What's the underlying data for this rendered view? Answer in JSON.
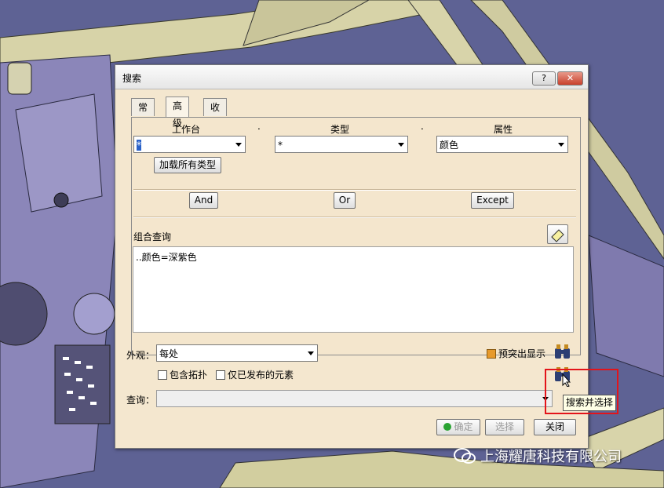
{
  "dialog": {
    "title": "搜索",
    "help_label": "?",
    "close_label": "✕"
  },
  "tabs": [
    {
      "label": "常规",
      "active": false
    },
    {
      "label": "高级",
      "active": true
    },
    {
      "label": "收藏夹",
      "active": false
    }
  ],
  "advanced": {
    "workbench_label": "工作台",
    "type_label": "类型",
    "attribute_label": "属性",
    "separator_dot": ".",
    "workbench_value": "*",
    "type_value": "*",
    "attribute_value": "颜色",
    "load_all_types_label": "加载所有类型",
    "and_label": "And",
    "or_label": "Or",
    "except_label": "Except",
    "combined_query_label": "组合查询",
    "combined_query_text": "..颜色=深紫色"
  },
  "search_scope": {
    "appearance_label": "外观：",
    "appearance_value": "每处",
    "include_topology_label": "包含拓扑",
    "published_only_label": "仅已发布的元素",
    "highlight_label": "预突出显示",
    "query_label": "查询："
  },
  "footer": {
    "ok_label": "确定",
    "select_label": "选择",
    "close_label": "关闭"
  },
  "tooltip": "搜索并选择",
  "watermark": "上海耀唐科技有限公司",
  "colors": {
    "dialog_bg": "#f4e7cf",
    "highlight_box": "#e3141a",
    "close_button": "#c8402c"
  }
}
